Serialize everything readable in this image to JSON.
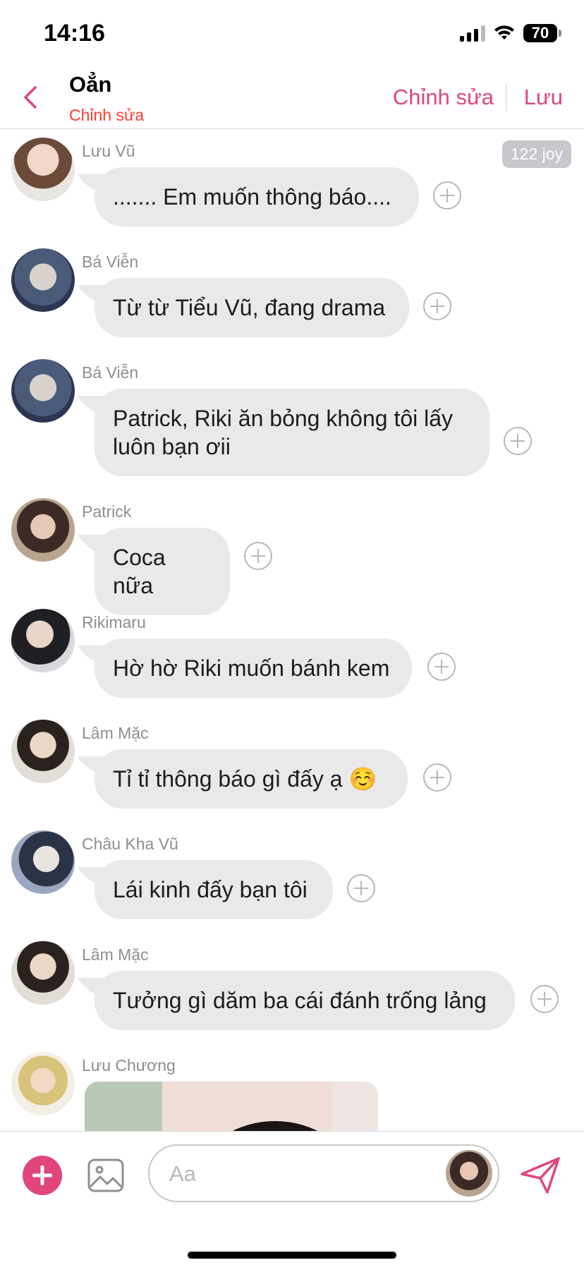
{
  "status_bar": {
    "time": "14:16",
    "battery": "70"
  },
  "header": {
    "title": "Oẳn",
    "subtitle": "Chỉnh sửa",
    "edit_label": "Chỉnh sửa",
    "save_label": "Lưu"
  },
  "messages": [
    {
      "sender": "Lưu Vũ",
      "text": "....... Em muốn thông báo....",
      "badge": "122 joy"
    },
    {
      "sender": "Bá Viễn",
      "text": "Từ từ Tiểu Vũ, đang drama"
    },
    {
      "sender": "Bá Viễn",
      "text": "Patrick, Riki ăn bỏng không tôi lấy luôn bạn ơii"
    },
    {
      "sender": "Patrick",
      "text": "Coca nữa"
    },
    {
      "sender": "Rikimaru",
      "text": "Hờ hờ Riki muốn bánh kem"
    },
    {
      "sender": "Lâm Mặc",
      "text": "Tỉ tỉ thông báo gì đấy ạ ☺️"
    },
    {
      "sender": "Châu Kha Vũ",
      "text": "Lái kinh đấy bạn tôi"
    },
    {
      "sender": "Lâm Mặc",
      "text": "Tưởng gì dăm ba cái đánh trống lảng"
    },
    {
      "sender": "Lưu Chương",
      "text": ""
    }
  ],
  "composer": {
    "placeholder": "Aa"
  },
  "colors": {
    "accent": "#e0467a",
    "subtitle": "#ff3b30",
    "bubble": "#e9e9eb"
  }
}
